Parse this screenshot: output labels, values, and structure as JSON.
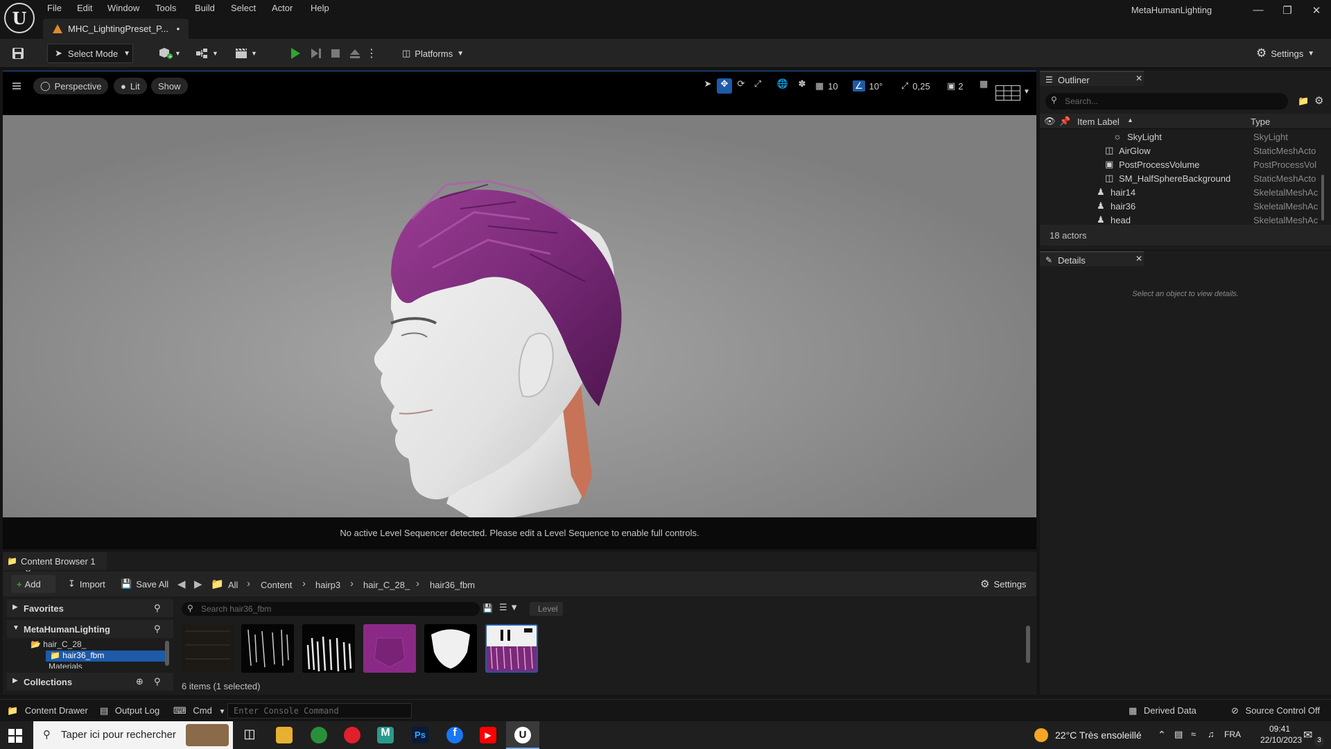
{
  "menu": [
    "File",
    "Edit",
    "Window",
    "Tools",
    "Build",
    "Select",
    "Actor",
    "Help"
  ],
  "app_title": "MetaHumanLighting",
  "document_tab": "MHC_LightingPreset_P...",
  "document_modified": "•",
  "toolbar": {
    "select_mode": "Select Mode",
    "platforms": "Platforms",
    "settings": "Settings"
  },
  "viewport": {
    "perspective": "Perspective",
    "lit": "Lit",
    "show": "Show",
    "grid_snap": "10",
    "rotation_snap": "10°",
    "scale_snap": "0,25",
    "camera_speed": "2",
    "status_message": "No active Level Sequencer detected. Please edit a Level Sequence to enable full controls."
  },
  "outliner": {
    "title": "Outliner",
    "search_placeholder": "Search...",
    "col_label": "Item Label",
    "col_type": "Type",
    "rows": [
      {
        "label": "SkyLight",
        "type": "SkyLight"
      },
      {
        "label": "AirGlow",
        "type": "StaticMeshActo"
      },
      {
        "label": "PostProcessVolume",
        "type": "PostProcessVol"
      },
      {
        "label": "SM_HalfSphereBackground",
        "type": "StaticMeshActo"
      },
      {
        "label": "hair14",
        "type": "SkeletalMeshAc"
      },
      {
        "label": "hair36",
        "type": "SkeletalMeshAc"
      },
      {
        "label": "head",
        "type": "SkeletalMeshAc"
      }
    ],
    "count": "18 actors"
  },
  "details": {
    "title": "Details",
    "empty_message": "Select an object to view details."
  },
  "content_browser": {
    "tab": "Content Browser 1",
    "add": "Add",
    "import": "Import",
    "save_all": "Save All",
    "breadcrumbs": [
      "All",
      "Content",
      "hairp3",
      "hair_C_28_",
      "hair36_fbm"
    ],
    "settings": "Settings",
    "favorites": "Favorites",
    "project": "MetaHumanLighting",
    "tree": [
      "hair_C_28_",
      "hair36_fbm",
      "Materials"
    ],
    "collections": "Collections",
    "search_placeholder": "Search hair36_fbm",
    "level_chip": "Level",
    "status": "6 items (1 selected)"
  },
  "statusbar": {
    "content_drawer": "Content Drawer",
    "output_log": "Output Log",
    "cmd": "Cmd",
    "console_placeholder": "Enter Console Command",
    "derived_data": "Derived Data",
    "source_control": "Source Control Off"
  },
  "taskbar": {
    "search": "Taper ici pour rechercher",
    "weather": "22°C  Très ensoleillé",
    "lang": "FRA",
    "time": "09:41",
    "date": "22/10/2023",
    "notifications": "3"
  },
  "colors": {
    "accent_blue": "#1e5aa8",
    "play_green": "#2fa52f",
    "hair_purple": "#7a2a78"
  }
}
